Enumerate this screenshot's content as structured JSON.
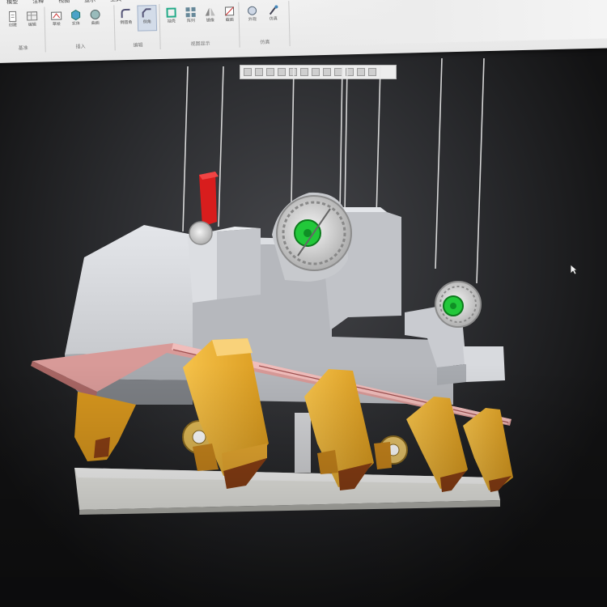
{
  "ribbon": {
    "menu_tabs": [
      "模型",
      "注释",
      "视图",
      "显示",
      "工具"
    ],
    "groups": [
      {
        "label": "基准"
      },
      {
        "label": "插入"
      },
      {
        "label": "编辑"
      },
      {
        "label": "视图显示"
      },
      {
        "label": "仿真"
      }
    ],
    "tools": [
      {
        "name": "create-tool",
        "label": "创建"
      },
      {
        "name": "edit-tool",
        "label": "编辑"
      },
      {
        "name": "sketch-tool",
        "label": "草绘"
      },
      {
        "name": "body-tool",
        "label": "实体"
      },
      {
        "name": "surface-tool",
        "label": "曲面"
      },
      {
        "name": "round-tool",
        "label": "倒圆角"
      },
      {
        "name": "chamfer-tool",
        "label": "倒角"
      },
      {
        "name": "shell-tool",
        "label": "抽壳"
      },
      {
        "name": "pattern-tool",
        "label": "阵列"
      },
      {
        "name": "mirror-tool",
        "label": "镜像"
      },
      {
        "name": "section-tool",
        "label": "截面"
      },
      {
        "name": "appearance-tool",
        "label": "外观"
      },
      {
        "name": "layer-tool",
        "label": "图层"
      },
      {
        "name": "view-manager-tool",
        "label": "视图管理器"
      },
      {
        "name": "simulate-tool",
        "label": "仿真"
      }
    ]
  },
  "colors": {
    "model_grey": "#c8cace",
    "tooth_orange": "#f2b632",
    "rail_pink": "#d89a98",
    "green_hub": "#22c83a",
    "red_marker": "#d81d1d",
    "base_plate": "#ecece6"
  }
}
